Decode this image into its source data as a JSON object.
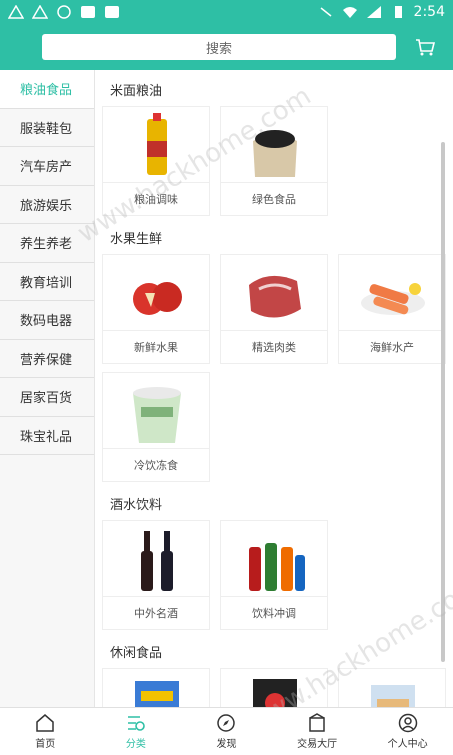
{
  "status": {
    "time": "2:54"
  },
  "search": {
    "placeholder": "搜索"
  },
  "sidebar": {
    "items": [
      {
        "label": "粮油食品"
      },
      {
        "label": "服装鞋包"
      },
      {
        "label": "汽车房产"
      },
      {
        "label": "旅游娱乐"
      },
      {
        "label": "养生养老"
      },
      {
        "label": "教育培训"
      },
      {
        "label": "数码电器"
      },
      {
        "label": "营养保健"
      },
      {
        "label": "居家百货"
      },
      {
        "label": "珠宝礼品"
      }
    ]
  },
  "sections": [
    {
      "title": "米面粮油",
      "items": [
        {
          "label": "粮油调味"
        },
        {
          "label": "绿色食品"
        }
      ]
    },
    {
      "title": "水果生鲜",
      "items": [
        {
          "label": "新鲜水果"
        },
        {
          "label": "精选肉类"
        },
        {
          "label": "海鲜水产"
        },
        {
          "label": "冷饮冻食"
        }
      ]
    },
    {
      "title": "酒水饮料",
      "items": [
        {
          "label": "中外名酒"
        },
        {
          "label": "饮料冲调"
        }
      ]
    },
    {
      "title": "休闲食品",
      "items": []
    }
  ],
  "tabs": [
    {
      "label": "首页"
    },
    {
      "label": "分类"
    },
    {
      "label": "发现"
    },
    {
      "label": "交易大厅"
    },
    {
      "label": "个人中心"
    }
  ],
  "watermark": "www.hackhome.com",
  "colors": {
    "accent": "#2ebfa5"
  }
}
